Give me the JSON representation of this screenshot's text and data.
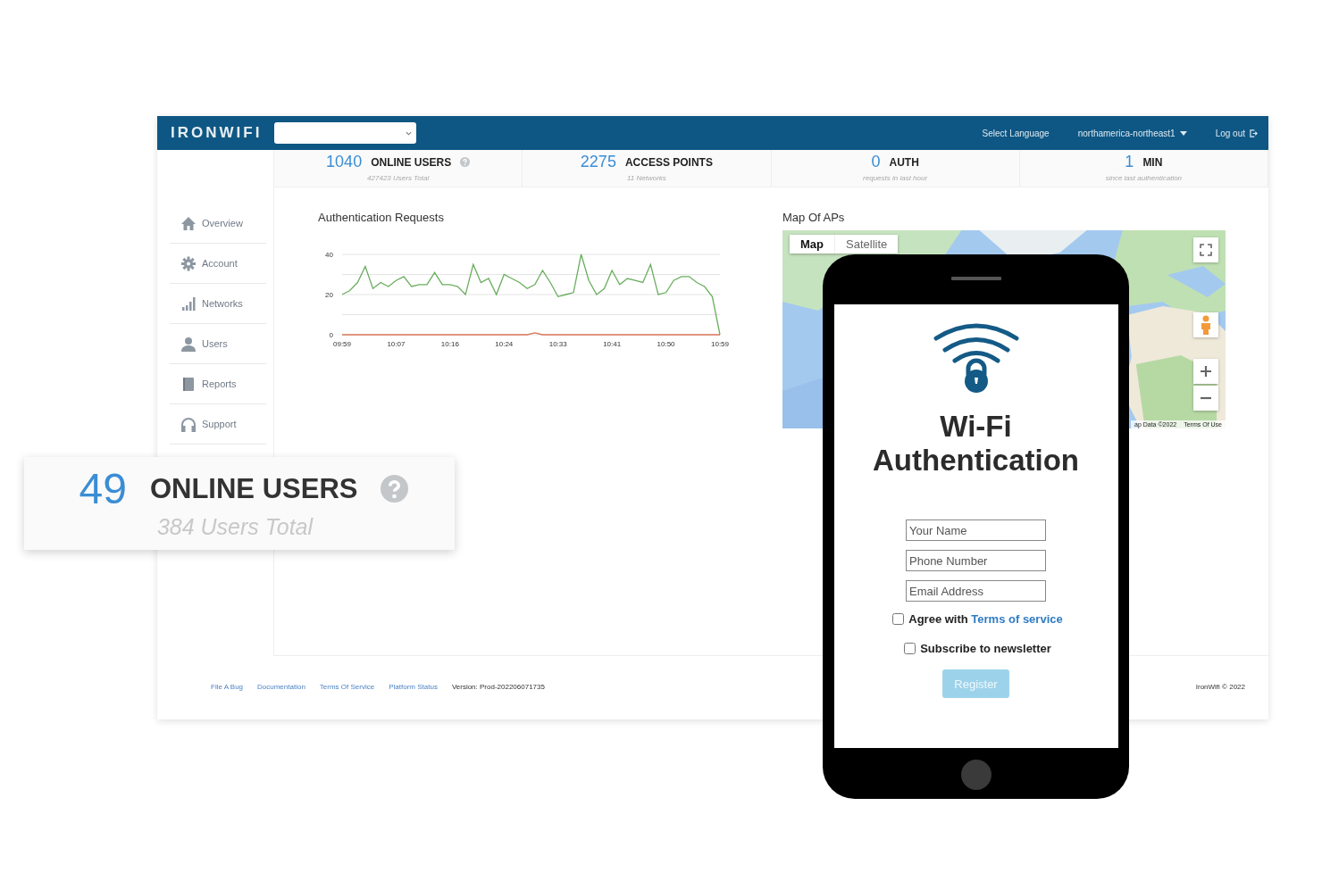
{
  "header": {
    "logo": "IRONWIFI",
    "language": "Select Language",
    "region": "northamerica-northeast1",
    "logout": "Log out"
  },
  "stats": [
    {
      "value": "1040",
      "label": "ONLINE USERS",
      "sub": "427423 Users Total",
      "help": true
    },
    {
      "value": "2275",
      "label": "ACCESS POINTS",
      "sub": "11 Networks",
      "help": false
    },
    {
      "value": "0",
      "label": "AUTH",
      "sub": "requests in last hour",
      "help": false
    },
    {
      "value": "1",
      "label": "MIN",
      "sub": "since last authentication",
      "help": false
    }
  ],
  "sidebar": {
    "items": [
      {
        "label": "Overview"
      },
      {
        "label": "Account"
      },
      {
        "label": "Networks"
      },
      {
        "label": "Users"
      },
      {
        "label": "Reports"
      },
      {
        "label": "Support"
      }
    ]
  },
  "chart": {
    "title": "Authentication Requests",
    "chart_data": {
      "type": "line",
      "categories": [
        "09:59",
        null,
        null,
        null,
        null,
        null,
        null,
        "10:07",
        null,
        null,
        null,
        null,
        null,
        null,
        "10:16",
        null,
        null,
        null,
        null,
        null,
        null,
        "10:24",
        null,
        null,
        null,
        null,
        null,
        null,
        "10:33",
        null,
        null,
        null,
        null,
        null,
        null,
        "10:41",
        null,
        null,
        null,
        null,
        null,
        null,
        "10:50",
        null,
        null,
        null,
        null,
        null,
        null,
        "10:59"
      ],
      "series": [
        {
          "color": "#6aae5e",
          "values": [
            20,
            22,
            26,
            34,
            23,
            26,
            24,
            27,
            29,
            24,
            25,
            25,
            31,
            25,
            25,
            24,
            20,
            35,
            26,
            28,
            20,
            30,
            28,
            26,
            23,
            25,
            32,
            26,
            19,
            20,
            21,
            40,
            27,
            20,
            23,
            32,
            25,
            28,
            27,
            26,
            35,
            20,
            21,
            27,
            29,
            29,
            26,
            24,
            19,
            0
          ]
        },
        {
          "color": "#d9785a",
          "values": [
            0,
            0,
            0,
            0,
            0,
            0,
            0,
            0,
            0,
            0,
            0,
            0,
            0,
            0,
            0,
            0,
            0,
            0,
            0,
            0,
            0,
            0,
            0,
            0,
            0,
            1,
            0,
            0,
            0,
            0,
            0,
            0,
            0,
            0,
            0,
            0,
            0,
            0,
            0,
            0,
            0,
            0,
            0,
            0,
            0,
            0,
            0,
            0,
            0,
            0
          ]
        }
      ],
      "ylim": [
        0,
        40
      ],
      "yticks": [
        0,
        20,
        40
      ]
    }
  },
  "map": {
    "title": "Map Of APs",
    "tabs": [
      {
        "label": "Map",
        "selected": true
      },
      {
        "label": "Satellite",
        "selected": false
      }
    ],
    "attribution": [
      "ap Data ©2022",
      "Terms Of Use"
    ]
  },
  "footer": {
    "links": [
      "File A Bug",
      "Documentation",
      "Terms Of Service",
      "Platform Status"
    ],
    "version": "Version: Prod-202206071735",
    "copyright": "IronWifi © 2022"
  },
  "callout": {
    "value": "49",
    "label": "ONLINE USERS",
    "sub": "384 Users Total"
  },
  "phone": {
    "title": "Wi-Fi Authentication",
    "fields": [
      {
        "placeholder": "Your Name"
      },
      {
        "placeholder": "Phone Number"
      },
      {
        "placeholder": "Email Address"
      }
    ],
    "agree": {
      "label": "Agree with",
      "link": "Terms of service",
      "checked": false
    },
    "newsletter": {
      "label": "Subscribe to newsletter",
      "checked": false
    },
    "register": {
      "label": "Register",
      "disabled": true
    }
  }
}
